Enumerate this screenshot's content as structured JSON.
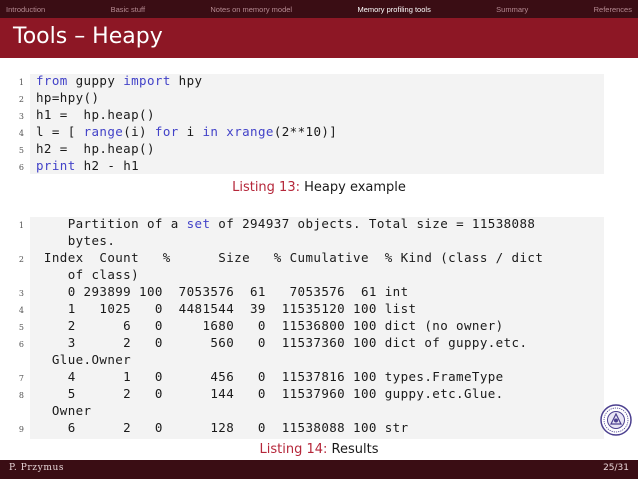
{
  "nav": {
    "items": [
      {
        "label": "Introduction"
      },
      {
        "label": "Basic stuff"
      },
      {
        "label": "Notes on memory model"
      },
      {
        "label": "Memory profiling tools"
      },
      {
        "label": "Summary"
      },
      {
        "label": "References"
      }
    ],
    "active_index": 3
  },
  "frame_title": "Tools – Heapy",
  "listing1": {
    "lines": [
      {
        "num": "1",
        "parts": [
          {
            "t": "from",
            "kw": true
          },
          {
            "t": " guppy "
          },
          {
            "t": "import",
            "kw": true
          },
          {
            "t": " hpy"
          }
        ]
      },
      {
        "num": "2",
        "parts": [
          {
            "t": "hp=hpy()"
          }
        ]
      },
      {
        "num": "3",
        "parts": [
          {
            "t": "h1 =  hp.heap()"
          }
        ]
      },
      {
        "num": "4",
        "parts": [
          {
            "t": "l = [ "
          },
          {
            "t": "range",
            "kw": true
          },
          {
            "t": "(i) "
          },
          {
            "t": "for",
            "kw": true
          },
          {
            "t": " i "
          },
          {
            "t": "in",
            "kw": true
          },
          {
            "t": " "
          },
          {
            "t": "xrange",
            "kw": true
          },
          {
            "t": "(2**10)]"
          }
        ]
      },
      {
        "num": "5",
        "parts": [
          {
            "t": "h2 =  hp.heap()"
          }
        ]
      },
      {
        "num": "6",
        "parts": [
          {
            "t": "print",
            "kw": true
          },
          {
            "t": " h2 - h1"
          }
        ]
      }
    ],
    "caption_label": "Listing 13:",
    "caption_text": "Heapy example"
  },
  "listing2": {
    "lines": [
      {
        "num": "1",
        "parts": [
          {
            "t": "    Partition of a "
          },
          {
            "t": "set",
            "kw": true
          },
          {
            "t": " of 294937 objects. Total size = 11538088"
          }
        ]
      },
      {
        "num": "",
        "parts": [
          {
            "t": "    bytes."
          }
        ]
      },
      {
        "num": "2",
        "parts": [
          {
            "t": " Index  Count   %      Size   % Cumulative  % Kind (class / dict"
          }
        ]
      },
      {
        "num": "",
        "parts": [
          {
            "t": "    of class)"
          }
        ]
      },
      {
        "num": "3",
        "parts": [
          {
            "t": "    0 293899 100  7053576  61   7053576  61 int"
          }
        ]
      },
      {
        "num": "4",
        "parts": [
          {
            "t": "    1   1025   0  4481544  39  11535120 100 list"
          }
        ]
      },
      {
        "num": "5",
        "parts": [
          {
            "t": "    2      6   0     1680   0  11536800 100 dict (no owner)"
          }
        ]
      },
      {
        "num": "6",
        "parts": [
          {
            "t": "    3      2   0      560   0  11537360 100 dict of guppy.etc."
          }
        ]
      },
      {
        "num": "",
        "parts": [
          {
            "t": "  Glue.Owner"
          }
        ]
      },
      {
        "num": "7",
        "parts": [
          {
            "t": "    4      1   0      456   0  11537816 100 types.FrameType"
          }
        ]
      },
      {
        "num": "8",
        "parts": [
          {
            "t": "    5      2   0      144   0  11537960 100 guppy.etc.Glue."
          }
        ]
      },
      {
        "num": "",
        "parts": [
          {
            "t": "  Owner"
          }
        ]
      },
      {
        "num": "9",
        "parts": [
          {
            "t": "    6      2   0      128   0  11538088 100 str"
          }
        ]
      }
    ],
    "caption_label": "Listing 14:",
    "caption_text": "Results"
  },
  "footer": {
    "author": "P. Przymus",
    "page": "25/31"
  },
  "colors": {
    "nav_bg": "#3a0d14",
    "title_bg": "#8d1725",
    "keyword": "#4242c8",
    "caption_label": "#b5273a",
    "code_bg": "#f3f3f3"
  },
  "icons": {
    "seal": "university-seal-icon"
  }
}
